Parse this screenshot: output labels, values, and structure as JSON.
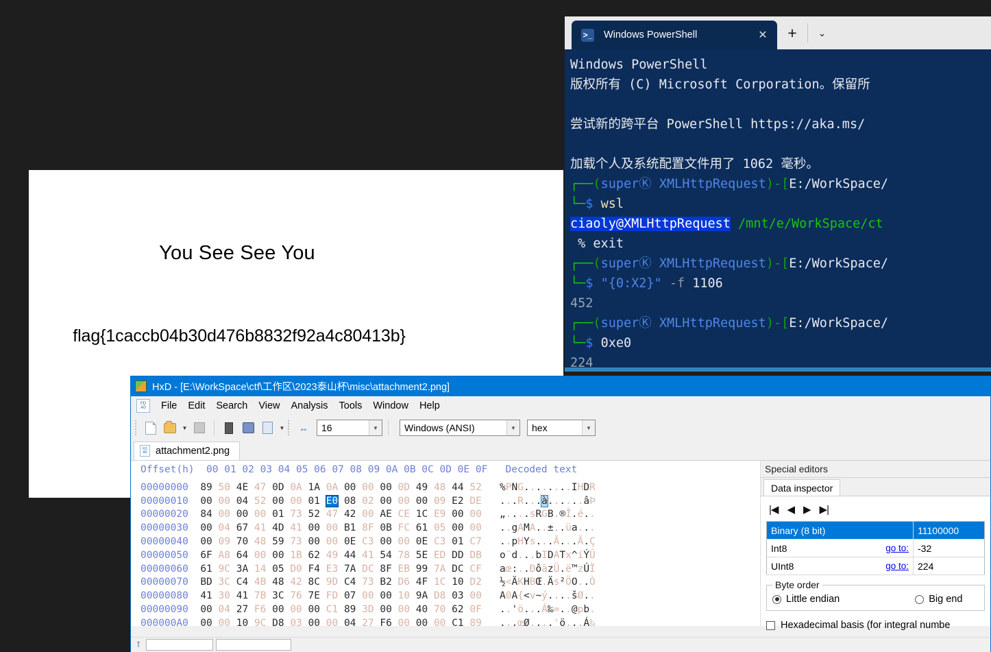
{
  "desktop": {
    "background_color": "#1e1e1e"
  },
  "viewer": {
    "title_text": "You See See You",
    "flag_text": "flag{1caccb04b30d476b8832f92a4c80413b}"
  },
  "powershell": {
    "tab": {
      "label": "Windows PowerShell",
      "icon": "powershell-icon",
      "close_icon": "✕"
    },
    "new_tab_icon": "+",
    "dropdown_icon": "⌄",
    "colors": {
      "background": "#0c2c5a",
      "selection": "#0037da",
      "green": "#16c60c",
      "blue": "#4e86e8"
    },
    "lines": [
      {
        "id": "l1",
        "segs": [
          {
            "t": "Windows PowerShell",
            "c": "c-white"
          }
        ]
      },
      {
        "id": "l2",
        "segs": [
          {
            "t": "版权所有 (C) Microsoft Corporation。保留所",
            "c": "c-white"
          }
        ]
      },
      {
        "id": "l3",
        "segs": [
          {
            "t": "",
            "c": "c-white"
          }
        ]
      },
      {
        "id": "l4",
        "segs": [
          {
            "t": "尝试新的跨平台 PowerShell https://aka.ms/",
            "c": "c-white"
          }
        ]
      },
      {
        "id": "l5",
        "segs": [
          {
            "t": "",
            "c": "c-white"
          }
        ]
      },
      {
        "id": "l6",
        "segs": [
          {
            "t": "加载个人及系统配置文件用了 1062 毫秒。",
            "c": "c-white"
          }
        ]
      },
      {
        "id": "l7",
        "segs": [
          {
            "t": "┌──",
            "c": "c-green"
          },
          {
            "t": "(",
            "c": "c-grn2"
          },
          {
            "t": "superⓀ XMLHttpRequest",
            "c": "c-blue"
          },
          {
            "t": ")-[",
            "c": "c-grn2"
          },
          {
            "t": "E:/WorkSpace/",
            "c": "c-white"
          }
        ]
      },
      {
        "id": "l8",
        "segs": [
          {
            "t": "└─",
            "c": "c-green"
          },
          {
            "t": "$",
            "c": "c-lblue"
          },
          {
            "t": " ",
            "c": "c-white"
          },
          {
            "t": "wsl",
            "c": "c-yellow"
          }
        ]
      },
      {
        "id": "l9",
        "segs": [
          {
            "t": "ciaoly@XMLHttpRequest",
            "c": "c-sel"
          },
          {
            "t": " ",
            "c": "c-white"
          },
          {
            "t": "/mnt/e/WorkSpace/ct",
            "c": "c-green"
          }
        ]
      },
      {
        "id": "l10",
        "segs": [
          {
            "t": " % exit",
            "c": "c-white"
          }
        ]
      },
      {
        "id": "l11",
        "segs": [
          {
            "t": "┌──",
            "c": "c-green"
          },
          {
            "t": "(",
            "c": "c-grn2"
          },
          {
            "t": "superⓀ XMLHttpRequest",
            "c": "c-blue"
          },
          {
            "t": ")-[",
            "c": "c-grn2"
          },
          {
            "t": "E:/WorkSpace/",
            "c": "c-white"
          }
        ]
      },
      {
        "id": "l12",
        "segs": [
          {
            "t": "└─",
            "c": "c-green"
          },
          {
            "t": "$",
            "c": "c-lblue"
          },
          {
            "t": " ",
            "c": "c-white"
          },
          {
            "t": "\"{0:X2}\"",
            "c": "c-blue"
          },
          {
            "t": " ",
            "c": "c-white"
          },
          {
            "t": "-f",
            "c": "c-dim"
          },
          {
            "t": " 1106",
            "c": "c-white"
          }
        ]
      },
      {
        "id": "l13",
        "segs": [
          {
            "t": "452",
            "c": "c-gray"
          }
        ]
      },
      {
        "id": "l14",
        "segs": [
          {
            "t": "┌──",
            "c": "c-green"
          },
          {
            "t": "(",
            "c": "c-grn2"
          },
          {
            "t": "superⓀ XMLHttpRequest",
            "c": "c-blue"
          },
          {
            "t": ")-[",
            "c": "c-grn2"
          },
          {
            "t": "E:/WorkSpace/",
            "c": "c-white"
          }
        ]
      },
      {
        "id": "l15",
        "segs": [
          {
            "t": "└─",
            "c": "c-green"
          },
          {
            "t": "$",
            "c": "c-lblue"
          },
          {
            "t": " ",
            "c": "c-white"
          },
          {
            "t": "0xe0",
            "c": "c-white"
          }
        ]
      },
      {
        "id": "l16",
        "segs": [
          {
            "t": "224",
            "c": "c-gray"
          }
        ]
      }
    ]
  },
  "hxd": {
    "title": "HxD - [E:\\WorkSpace\\ctf\\工作区\\2023泰山杯\\misc\\attachment2.png]",
    "menu": [
      "File",
      "Edit",
      "Search",
      "View",
      "Analysis",
      "Tools",
      "Window",
      "Help"
    ],
    "toolbar": {
      "bytes_per_row": "16",
      "encoding": "Windows (ANSI)",
      "offset_base": "hex",
      "icons": [
        "new-file-icon",
        "open-file-icon",
        "open-dropdown-icon",
        "save-icon",
        "open-disk-icon",
        "open-ram-icon",
        "open-folder-icon",
        "open-dropdown2-icon",
        "row-width-icon"
      ]
    },
    "file_tab": {
      "label": "attachment2.png",
      "icon": "file-icon"
    },
    "hex_header": {
      "offset_label": "Offset(h)",
      "columns": [
        "00",
        "01",
        "02",
        "03",
        "04",
        "05",
        "06",
        "07",
        "08",
        "09",
        "0A",
        "0B",
        "0C",
        "0D",
        "0E",
        "0F"
      ],
      "decoded_label": "Decoded text"
    },
    "rows": [
      {
        "offset": "00000000",
        "bytes": [
          "89",
          "50",
          "4E",
          "47",
          "0D",
          "0A",
          "1A",
          "0A",
          "00",
          "00",
          "00",
          "0D",
          "49",
          "48",
          "44",
          "52"
        ],
        "text": "%PNG........IHDR",
        "sel": -1,
        "sel_text_index": -1
      },
      {
        "offset": "00000010",
        "bytes": [
          "00",
          "00",
          "04",
          "52",
          "00",
          "00",
          "01",
          "E0",
          "08",
          "02",
          "00",
          "00",
          "00",
          "09",
          "E2",
          "DE"
        ],
        "text": "...R....àÞ",
        "sel": 7,
        "sel_text_index": 7,
        "text_chars": [
          ".",
          ".",
          ".",
          "R",
          ".",
          ".",
          ".",
          "à",
          ".",
          ".",
          ".",
          ".",
          ".",
          ".",
          "â",
          "Þ"
        ]
      },
      {
        "offset": "00000020",
        "bytes": [
          "84",
          "00",
          "00",
          "00",
          "01",
          "73",
          "52",
          "47",
          "42",
          "00",
          "AE",
          "CE",
          "1C",
          "E9",
          "00",
          "00"
        ],
        "text": "„....sRGB.®Î.é..",
        "sel": -1
      },
      {
        "offset": "00000030",
        "bytes": [
          "00",
          "04",
          "67",
          "41",
          "4D",
          "41",
          "00",
          "00",
          "B1",
          "8F",
          "0B",
          "FC",
          "61",
          "05",
          "00",
          "00"
        ],
        "text": "..gAMA..±..üa...",
        "sel": -1
      },
      {
        "offset": "00000040",
        "bytes": [
          "00",
          "09",
          "70",
          "48",
          "59",
          "73",
          "00",
          "00",
          "0E",
          "C3",
          "00",
          "00",
          "0E",
          "C3",
          "01",
          "C7"
        ],
        "text": "..pHYs...Ä...Ä.Ç",
        "sel": -1
      },
      {
        "offset": "00000050",
        "bytes": [
          "6F",
          "A8",
          "64",
          "00",
          "00",
          "1B",
          "62",
          "49",
          "44",
          "41",
          "54",
          "78",
          "5E",
          "ED",
          "DD",
          "DB"
        ],
        "text": "o¨d...bIDATx^íÝÛ",
        "sel": -1
      },
      {
        "offset": "00000060",
        "bytes": [
          "61",
          "9C",
          "3A",
          "14",
          "05",
          "D0",
          "F4",
          "E3",
          "7A",
          "DC",
          "8F",
          "EB",
          "99",
          "7A",
          "DC",
          "CF"
        ],
        "text": "aœ:..ÐôãzÜ.ë™zÚÏ",
        "sel": -1
      },
      {
        "offset": "00000070",
        "bytes": [
          "BD",
          "3C",
          "C4",
          "4B",
          "48",
          "42",
          "8C",
          "9D",
          "C4",
          "73",
          "B2",
          "D6",
          "4F",
          "1C",
          "10",
          "D2"
        ],
        "text": "½<ÄKHBŒ.Äs²ÖO..Ò",
        "sel": -1
      },
      {
        "offset": "00000080",
        "bytes": [
          "41",
          "30",
          "41",
          "7B",
          "3C",
          "76",
          "7E",
          "FD",
          "07",
          "00",
          "00",
          "10",
          "9A",
          "D8",
          "03",
          "00"
        ],
        "text": "A0A{<v~ý....šØ..",
        "sel": -1
      },
      {
        "offset": "00000090",
        "bytes": [
          "00",
          "04",
          "27",
          "F6",
          "00",
          "00",
          "00",
          "C1",
          "89",
          "3D",
          "00",
          "00",
          "40",
          "70",
          "62",
          "0F"
        ],
        "text": "..'ö...Á‰=..@pb.",
        "sel": -1
      },
      {
        "offset": "000000A0",
        "bytes": [
          "00",
          "00",
          "10",
          "9C",
          "D8",
          "03",
          "00",
          "00",
          "04",
          "27",
          "F6",
          "00",
          "00",
          "00",
          "C1",
          "89"
        ],
        "text": "...œØ....'ö...Á‰",
        "sel": -1
      }
    ],
    "dock": {
      "special_editors_label": "Special editors",
      "tab_label": "Data inspector",
      "nav": {
        "first": "|◀",
        "prev": "◀",
        "next": "▶",
        "last": "▶|"
      },
      "inspector_rows": [
        {
          "label": "Binary (8 bit)",
          "goto": "",
          "value": "11100000",
          "selected": true
        },
        {
          "label": "Int8",
          "goto": "go to:",
          "value": "-32",
          "selected": false
        },
        {
          "label": "UInt8",
          "goto": "go to:",
          "value": "224",
          "selected": false
        }
      ],
      "byte_order": {
        "legend": "Byte order",
        "little": "Little endian",
        "big": "Big end",
        "selected": "little"
      },
      "hex_basis": {
        "label": "Hexadecimal basis (for integral numbe",
        "checked": false
      }
    }
  }
}
